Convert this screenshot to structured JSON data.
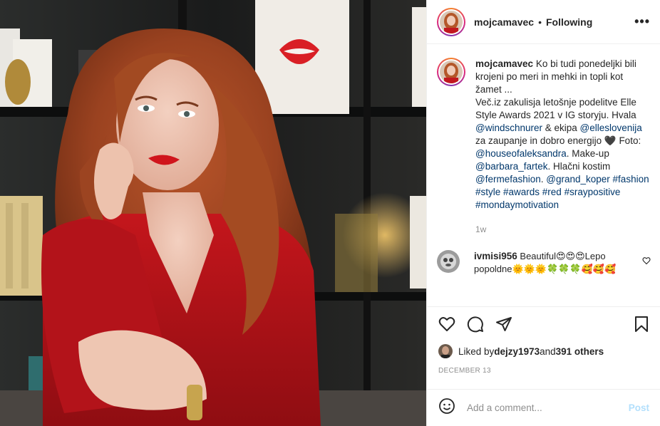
{
  "post": {
    "username": "mojcamavec",
    "separator": "•",
    "follow_status": "Following",
    "more": "•••"
  },
  "caption": {
    "username": "mojcamavec",
    "line1": "Ko bi tudi ponedeljki bili krojeni po meri in mehki in topli kot žamet ...",
    "line2a": "Več.iz zakulisja letošnje podelitve Elle Style Awards 2021 v IG storyju. Hvala ",
    "mention1": "@windschnurer",
    "line2b": " & ekipa ",
    "mention2": "@elleslovenija",
    "line2c": " za zaupanje in dobro energijo 🖤 Foto: ",
    "mention3": "@houseofaleksandra",
    "line2d": ". Make-up ",
    "mention4": "@barbara_fartek",
    "line2e": ". Hlačni kostim ",
    "mention5": "@fermefashion",
    "line2f": ". ",
    "mention6": "@grand_koper",
    "line2g": " ",
    "tags": "#fashion #style #awards #red #sraypositive #mondaymotivation",
    "time": "1w"
  },
  "comment": {
    "username": "ivmisi956",
    "text": " Beautiful😍😍😍Lepo popoldne🌞🌞🌞🍀🍀🍀🥰🥰🥰"
  },
  "likes": {
    "prefix": "Liked by ",
    "user": "dejzy1973",
    "middle": " and ",
    "others": "391 others"
  },
  "date": "December 13",
  "add_comment": {
    "placeholder": "Add a comment...",
    "post_label": "Post"
  },
  "icons": [
    "heart-icon",
    "comment-icon",
    "share-icon",
    "bookmark-icon",
    "emoji-icon",
    "more-icon"
  ]
}
